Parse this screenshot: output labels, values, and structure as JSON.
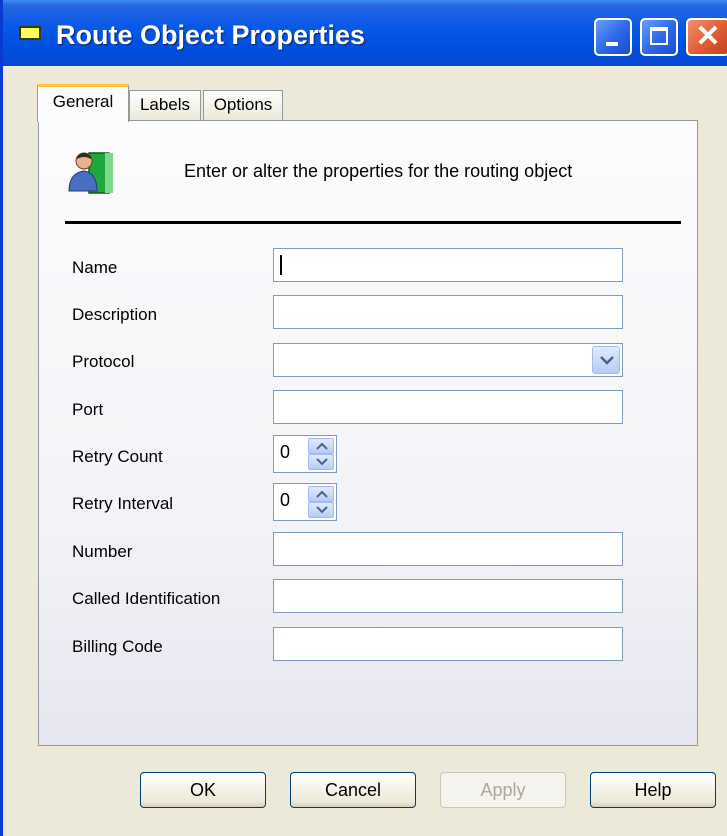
{
  "window": {
    "title": "Route Object Properties"
  },
  "tabs": [
    {
      "label": "General",
      "active": true
    },
    {
      "label": "Labels",
      "active": false
    },
    {
      "label": "Options",
      "active": false
    }
  ],
  "header": {
    "description": "Enter or alter the properties for the routing object",
    "icon": "users-book-icon"
  },
  "fields": {
    "name": {
      "label": "Name",
      "value": ""
    },
    "description": {
      "label": "Description",
      "value": ""
    },
    "protocol": {
      "label": "Protocol",
      "value": ""
    },
    "port": {
      "label": "Port",
      "value": ""
    },
    "retry_count": {
      "label": "Retry Count",
      "value": "0"
    },
    "retry_interval": {
      "label": "Retry Interval",
      "value": "0"
    },
    "number": {
      "label": "Number",
      "value": ""
    },
    "called_identification": {
      "label": "Called Identification",
      "value": ""
    },
    "billing_code": {
      "label": "Billing Code",
      "value": ""
    }
  },
  "buttons": {
    "ok": "OK",
    "cancel": "Cancel",
    "apply": "Apply",
    "help": "Help"
  },
  "colors": {
    "titlebar": "#0050df",
    "accent_tab": "#ffc83c",
    "close": "#e25b34"
  }
}
